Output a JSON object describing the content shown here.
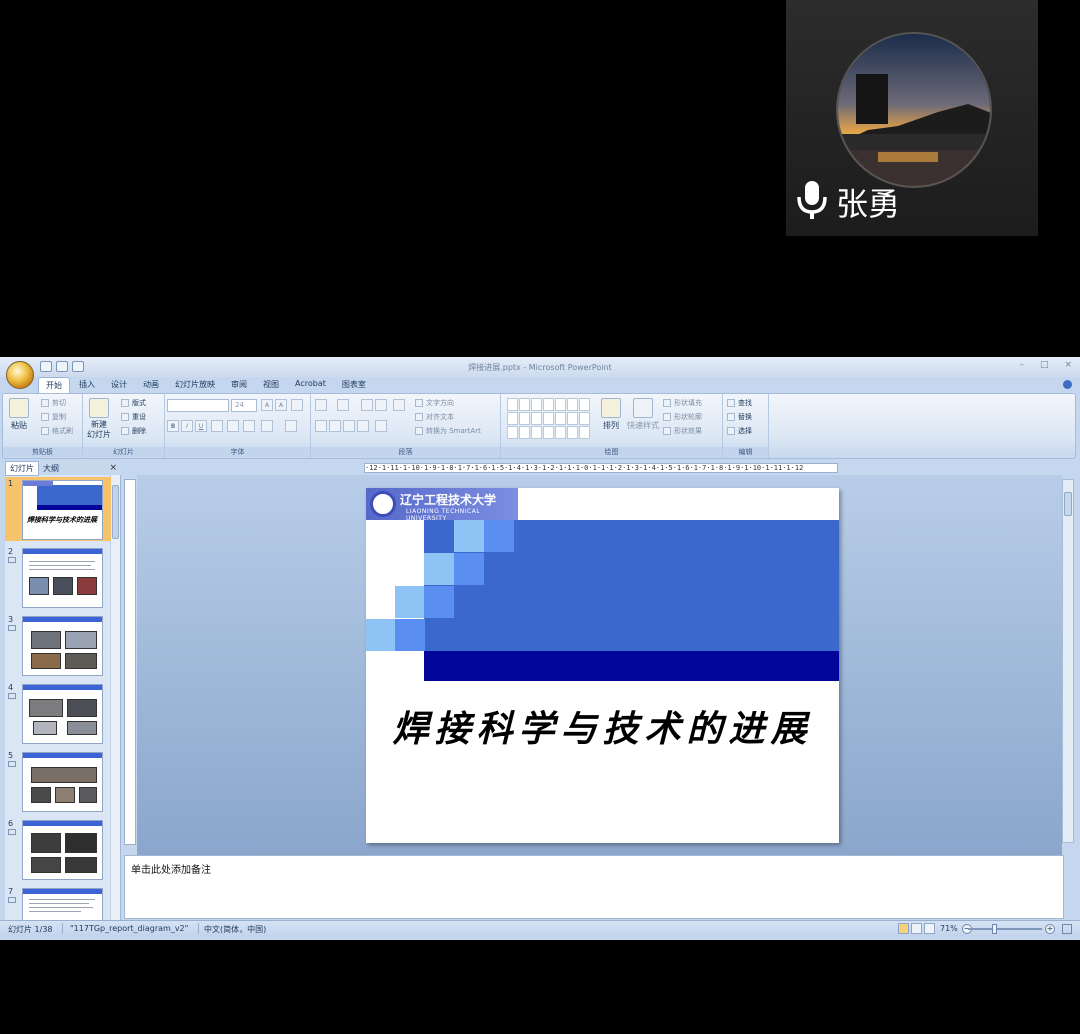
{
  "video_call": {
    "caller_name": "张勇",
    "mic_icon": "microphone-icon"
  },
  "window": {
    "title": "焊接进展.pptx - Microsoft PowerPoint",
    "controls": [
      "–",
      "□",
      "×"
    ]
  },
  "ribbon": {
    "tabs": [
      "开始",
      "插入",
      "设计",
      "动画",
      "幻灯片放映",
      "审阅",
      "视图",
      "Acrobat",
      "图表室"
    ],
    "active_tab": "开始",
    "groups": {
      "clipboard": {
        "label": "剪贴板",
        "paste": "粘贴",
        "cut": "剪切",
        "copy": "复制",
        "format_painter": "格式刷"
      },
      "slides": {
        "label": "幻灯片",
        "new_slide": "新建\n幻灯片",
        "layout": "版式",
        "reset": "重设",
        "delete": "删除"
      },
      "font": {
        "label": "字体",
        "font_name": "",
        "font_size": "24"
      },
      "paragraph": {
        "label": "段落",
        "text_direction": "文字方向",
        "align_text": "对齐文本",
        "smartart": "转换为 SmartArt"
      },
      "drawing": {
        "label": "绘图",
        "arrange": "排列",
        "quick_styles": "快速样式",
        "shape_fill": "形状填充",
        "shape_outline": "形状轮廓",
        "shape_effects": "形状效果"
      },
      "editing": {
        "label": "编辑",
        "find": "查找",
        "replace": "替换",
        "select": "选择"
      }
    }
  },
  "slide_pane": {
    "tabs": [
      "幻灯片",
      "大纲"
    ],
    "close": "×",
    "slide_numbers": [
      "1",
      "2",
      "3",
      "4",
      "5",
      "6",
      "7"
    ]
  },
  "ruler": {
    "horizontal": "·12·1·11·1·10·1·9·1·8·1·7·1·6·1·5·1·4·1·3·1·2·1·1·1·0·1·1·1·2·1·3·1·4·1·5·1·6·1·7·1·8·1·9·1·10·1·11·1·12"
  },
  "slide": {
    "university_cn": "辽宁工程技术大学",
    "university_en": "LIAONING TECHNICAL UNIVERSITY",
    "title": "焊接科学与技术的进展"
  },
  "notes": {
    "placeholder": "单击此处添加备注"
  },
  "status_bar": {
    "slide_counter": "幻灯片 1/38",
    "theme": "\"117TGp_report_diagram_v2\"",
    "language": "中文(简体，中国)",
    "zoom": "71%",
    "zoom_level": 0.35
  },
  "colors": {
    "slide_blue": "#3a68cc",
    "slide_navy": "#02069a",
    "light_square": "#8ec3f5",
    "mid_square": "#5a8ef0"
  }
}
